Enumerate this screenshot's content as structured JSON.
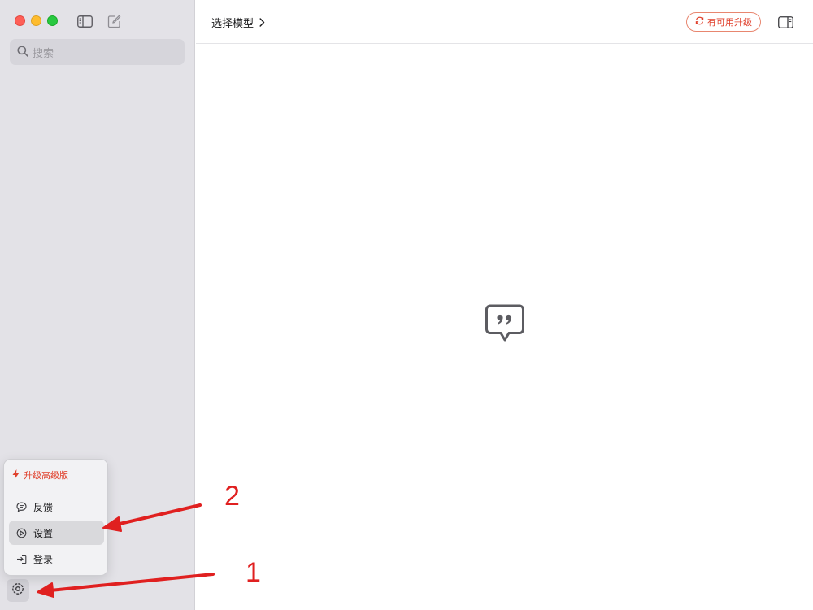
{
  "window": {
    "controls": [
      "close",
      "minimize",
      "zoom"
    ]
  },
  "toolbar": {
    "sidebar_toggle_icon": "sidebar-toggle-icon",
    "compose_icon": "compose-icon"
  },
  "search": {
    "placeholder": "搜索",
    "icon": "search-icon"
  },
  "menu": {
    "upgrade_label": "升级高级版",
    "items": [
      {
        "label": "反馈",
        "icon": "chat-bubble-icon"
      },
      {
        "label": "设置",
        "icon": "settings-icon"
      },
      {
        "label": "登录",
        "icon": "login-icon"
      }
    ]
  },
  "header": {
    "model_label": "选择模型",
    "update_label": "有可用升级",
    "accent_color": "#e0412d"
  },
  "main": {
    "empty_state_icon": "quote-bubble-icon"
  },
  "annotations": {
    "label_1": "1",
    "label_2": "2",
    "color": "#e02020"
  }
}
